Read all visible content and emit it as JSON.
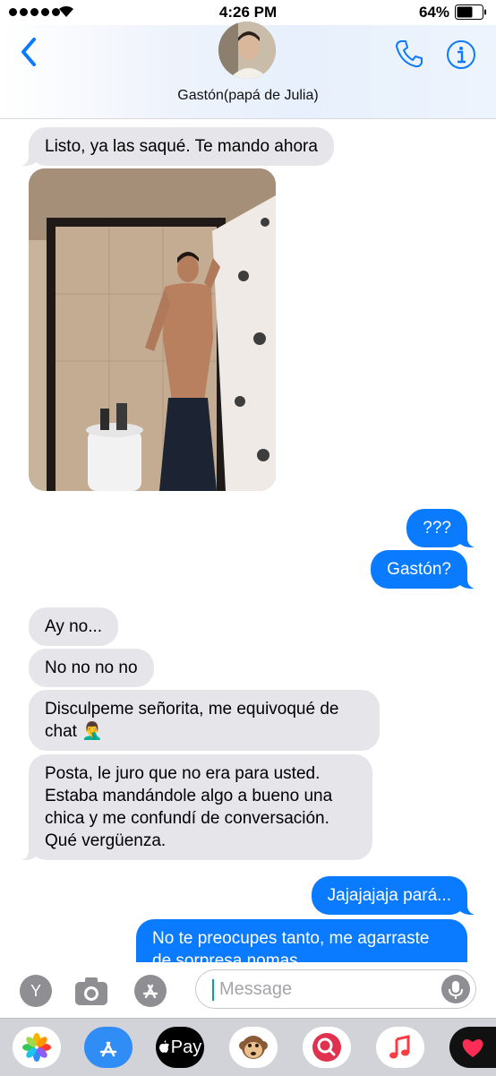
{
  "status_bar": {
    "time": "4:26 PM",
    "battery_percent": "64%",
    "battery_level": 0.64,
    "signal_bars": 5
  },
  "header": {
    "contact_name": "Gastón(papá de Julia)",
    "icons": [
      "chevron-left-icon",
      "phone-icon",
      "info-icon"
    ],
    "accent_color": "#0a7aff"
  },
  "messages": [
    {
      "from": "them",
      "text": "Listo, ya las saqué. Te mando ahora"
    },
    {
      "from": "them",
      "type": "photo"
    },
    {
      "from": "me",
      "text": "???"
    },
    {
      "from": "me",
      "text": "Gastón?"
    },
    {
      "from": "them",
      "text": "Ay no..."
    },
    {
      "from": "them",
      "text": "No no no no"
    },
    {
      "from": "them",
      "text": "Disculpeme señorita, me equivoqué de chat 🤦‍♂️"
    },
    {
      "from": "them",
      "text": "Posta, le juro que no era para usted. Estaba mandándole algo a bueno una chica  y me confundí de conversación. Qué vergüenza."
    },
    {
      "from": "me",
      "text": "Jajajajaja pará..."
    },
    {
      "from": "me",
      "text": "No te preocupes tanto, me agarraste de sorpresa nomas"
    }
  ],
  "input_bar": {
    "left_button_label": "Y",
    "placeholder": "Message"
  },
  "app_drawer": {
    "apps": [
      "photos-icon",
      "app-store-icon",
      "apple-pay-icon",
      "monkey-emoji-icon",
      "search-images-icon",
      "music-icon",
      "heart-icon"
    ],
    "apple_pay_label": "Pay"
  }
}
